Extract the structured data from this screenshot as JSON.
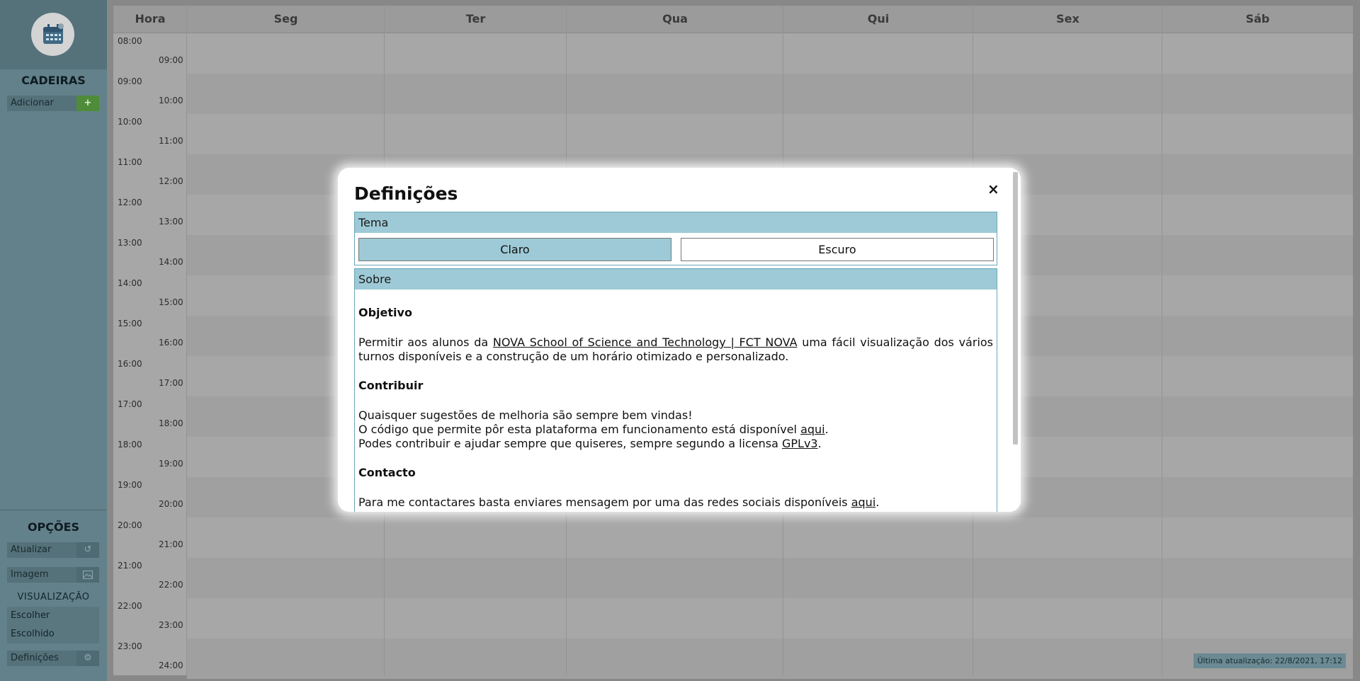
{
  "sidebar": {
    "cadeiras_title": "CADEIRAS",
    "add_label": "Adicionar",
    "add_icon": "+",
    "opcoes_title": "OPÇÕES",
    "atualizar_label": "Atualizar",
    "imagem_label": "Imagem",
    "visualizacao_title": "VISUALIZAÇÃO",
    "escolher_label": "Escolher",
    "escolhido_label": "Escolhido",
    "definicoes_label": "Definições"
  },
  "calendar": {
    "hour_header": "Hora",
    "days": [
      "Seg",
      "Ter",
      "Qua",
      "Qui",
      "Sex",
      "Sáb"
    ],
    "times_left": [
      "08:00",
      "09:00",
      "10:00",
      "11:00",
      "12:00",
      "13:00",
      "14:00",
      "15:00",
      "16:00",
      "17:00",
      "18:00",
      "19:00",
      "20:00",
      "21:00",
      "22:00",
      "23:00"
    ],
    "times_right": [
      "09:00",
      "10:00",
      "11:00",
      "12:00",
      "13:00",
      "14:00",
      "15:00",
      "16:00",
      "17:00",
      "18:00",
      "19:00",
      "20:00",
      "21:00",
      "22:00",
      "23:00",
      "24:00"
    ],
    "last_update": "Última atualização: 22/8/2021, 17:12"
  },
  "modal": {
    "title": "Definições",
    "close": "×",
    "theme_header": "Tema",
    "theme_light": "Claro",
    "theme_dark": "Escuro",
    "about_header": "Sobre",
    "objective_title": "Objetivo",
    "objective_pre": "Permitir aos alunos da ",
    "objective_link": "NOVA School of Science and Technology | FCT NOVA",
    "objective_post": " uma fácil visualização dos vários turnos disponíveis e a construção de um horário otimizado e personalizado.",
    "contribute_title": "Contribuir",
    "contribute_line1": "Quaisquer sugestões de melhoria são sempre bem vindas!",
    "contribute_line2_pre": "O código que permite pôr esta plataforma em funcionamento está disponível ",
    "contribute_line2_link": "aqui",
    "contribute_line2_post": ".",
    "contribute_line3_pre": "Podes contribuir e ajudar sempre que quiseres, sempre segundo a licensa ",
    "contribute_line3_link": "GPLv3",
    "contribute_line3_post": ".",
    "contact_title": "Contacto",
    "contact_pre": "Para me contactares basta enviares mensagem por uma das redes sociais disponíveis ",
    "contact_link": "aqui",
    "contact_post": "."
  },
  "colors": {
    "accent": "#9dcad6",
    "sidebar": "#62818b",
    "add_button": "#4f8c3a"
  }
}
